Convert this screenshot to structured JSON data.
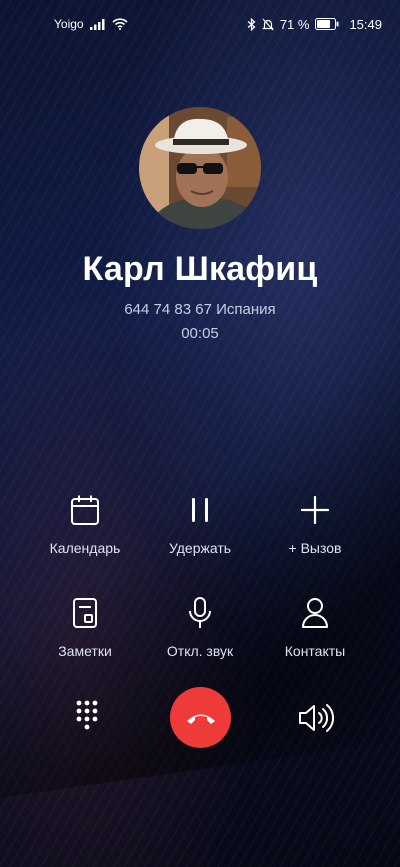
{
  "status_bar": {
    "carrier": "Yoigo",
    "battery_percent": "71 %",
    "battery_level": 0.71,
    "time": "15:49"
  },
  "caller": {
    "name": "Карл Шкафиц",
    "number_and_region": "644 74 83 67 Испания",
    "duration": "00:05"
  },
  "actions": {
    "calendar": "Календарь",
    "hold": "Удержать",
    "add_call": "+ Вызов",
    "notes": "Заметки",
    "mute": "Откл. звук",
    "contacts": "Контакты"
  },
  "icons": {
    "calendar": "calendar-icon",
    "hold": "pause-icon",
    "add_call": "plus-icon",
    "notes": "notes-icon",
    "mute": "microphone-icon",
    "contacts": "person-icon",
    "dialpad": "dialpad-icon",
    "end_call": "phone-hangup-icon",
    "speaker": "speaker-icon"
  },
  "colors": {
    "end_call": "#ee3b3a",
    "background_top": "#0b1430",
    "background_bottom": "#050814"
  }
}
